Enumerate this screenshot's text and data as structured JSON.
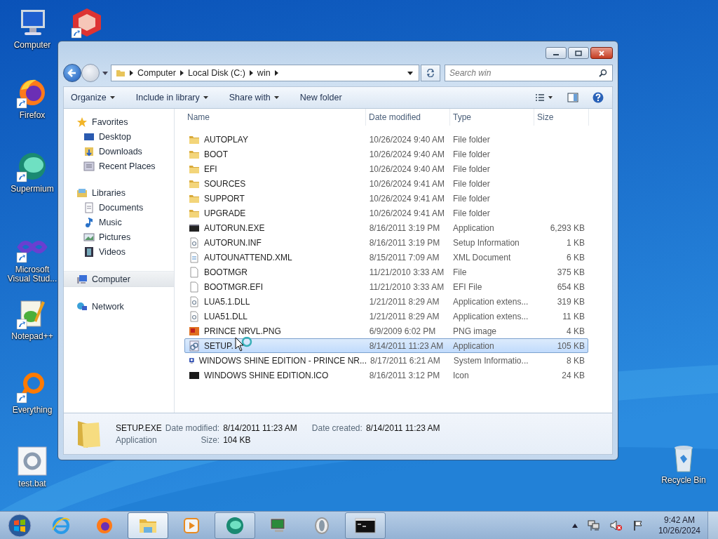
{
  "desktop_icons": [
    {
      "kind": "computer",
      "label": "Computer"
    },
    {
      "kind": "red-box"
    },
    {
      "kind": "firefox",
      "label": "Firefox"
    },
    {
      "kind": "supermium",
      "label": "Supermium"
    },
    {
      "kind": "infinity",
      "label": "Microsoft Visual Stud..."
    },
    {
      "kind": "notepad",
      "label": "Notepad++"
    },
    {
      "kind": "everything",
      "label": "Everything"
    },
    {
      "kind": "bat",
      "label": "test.bat"
    },
    {
      "kind": "recycle",
      "label": "Recycle Bin"
    }
  ],
  "window": {
    "breadcrumb": [
      "Computer",
      "Local Disk (C:)",
      "win"
    ],
    "search": {
      "placeholder": "Search win"
    },
    "toolbar": [
      {
        "label": "Organize",
        "dropdown": true
      },
      {
        "label": "Include in library",
        "dropdown": true
      },
      {
        "label": "Share with",
        "dropdown": true
      },
      {
        "label": "New folder",
        "dropdown": false
      }
    ],
    "nav": [
      {
        "label": "Favorites",
        "kind": "star",
        "selected": false,
        "children": [
          {
            "label": "Desktop",
            "kind": "desktop",
            "selected": false
          },
          {
            "label": "Downloads",
            "kind": "downloads",
            "selected": false
          },
          {
            "label": "Recent Places",
            "kind": "recent",
            "selected": false
          }
        ]
      },
      {
        "label": "Libraries",
        "kind": "library",
        "selected": false,
        "children": [
          {
            "label": "Documents",
            "kind": "doc",
            "selected": false
          },
          {
            "label": "Music",
            "kind": "music",
            "selected": false
          },
          {
            "label": "Pictures",
            "kind": "pictures",
            "selected": false
          },
          {
            "label": "Videos",
            "kind": "videos",
            "selected": false
          }
        ]
      },
      {
        "label": "Computer",
        "kind": "computer",
        "selected": true
      },
      {
        "label": "Network",
        "kind": "network",
        "selected": false
      }
    ],
    "columns": [
      "Name",
      "Date modified",
      "Type",
      "Size"
    ],
    "rows": [
      {
        "kind": "folder",
        "name": "AUTOPLAY",
        "date": "10/26/2024 9:40 AM",
        "type": "File folder",
        "selected": false
      },
      {
        "kind": "folder",
        "name": "BOOT",
        "date": "10/26/2024 9:40 AM",
        "type": "File folder",
        "selected": false
      },
      {
        "kind": "folder",
        "name": "EFI",
        "date": "10/26/2024 9:40 AM",
        "type": "File folder",
        "selected": false
      },
      {
        "kind": "folder",
        "name": "SOURCES",
        "date": "10/26/2024 9:41 AM",
        "type": "File folder",
        "selected": false
      },
      {
        "kind": "folder",
        "name": "SUPPORT",
        "date": "10/26/2024 9:41 AM",
        "type": "File folder",
        "selected": false
      },
      {
        "kind": "folder",
        "name": "UPGRADE",
        "date": "10/26/2024 9:41 AM",
        "type": "File folder",
        "selected": false
      },
      {
        "kind": "exe",
        "name": "AUTORUN.EXE",
        "date": "8/16/2011 3:19 PM",
        "type": "Application",
        "size": "6,293 KB",
        "selected": false
      },
      {
        "kind": "inf",
        "name": "AUTORUN.INF",
        "date": "8/16/2011 3:19 PM",
        "type": "Setup Information",
        "size": "1 KB",
        "selected": false
      },
      {
        "kind": "xml",
        "name": "AUTOUNATTEND.XML",
        "date": "8/15/2011 7:09 AM",
        "type": "XML Document",
        "size": "6 KB",
        "selected": false
      },
      {
        "kind": "file",
        "name": "BOOTMGR",
        "date": "11/21/2010 3:33 AM",
        "type": "File",
        "size": "375 KB",
        "selected": false
      },
      {
        "kind": "file",
        "name": "BOOTMGR.EFI",
        "date": "11/21/2010 3:33 AM",
        "type": "EFI File",
        "size": "654 KB",
        "selected": false
      },
      {
        "kind": "dll",
        "name": "LUA5.1.DLL",
        "date": "1/21/2011 8:29 AM",
        "type": "Application extens...",
        "size": "319 KB",
        "selected": false
      },
      {
        "kind": "dll",
        "name": "LUA51.DLL",
        "date": "1/21/2011 8:29 AM",
        "type": "Application extens...",
        "size": "11 KB",
        "selected": false
      },
      {
        "kind": "png",
        "name": "PRINCE NRVL.PNG",
        "date": "6/9/2009 6:02 PM",
        "type": "PNG image",
        "size": "4 KB",
        "selected": false
      },
      {
        "kind": "setup",
        "name": "SETUP.",
        "date": "8/14/2011 11:23 AM",
        "type": "Application",
        "size": "105 KB",
        "selected": true,
        "cursor": true
      },
      {
        "kind": "sysinfo",
        "name": "WINDOWS SHINE EDITION - PRINCE NR...",
        "date": "8/17/2011 6:21 AM",
        "type": "System Informatio...",
        "size": "8 KB",
        "selected": false
      },
      {
        "kind": "ico",
        "name": "WINDOWS SHINE EDITION.ICO",
        "date": "8/16/2011 3:12 PM",
        "type": "Icon",
        "size": "24 KB",
        "selected": false
      }
    ],
    "details": {
      "name": "SETUP.EXE",
      "type": "Application",
      "fields": [
        {
          "label": "Date modified:",
          "value": "8/14/2011 11:23 AM"
        },
        {
          "label": "Size:",
          "value": "104 KB"
        },
        {
          "label": "Date created:",
          "value": "8/14/2011 11:23 AM"
        }
      ]
    }
  },
  "taskbar": {
    "items": [
      {
        "kind": "ie",
        "open": false,
        "active": false
      },
      {
        "kind": "firefox",
        "open": false,
        "active": false
      },
      {
        "kind": "explorer",
        "open": true,
        "active": true
      },
      {
        "kind": "media",
        "open": false,
        "active": false
      },
      {
        "kind": "supermium",
        "open": true,
        "active": false
      },
      {
        "kind": "monitor",
        "open": false,
        "active": false
      },
      {
        "kind": "opera",
        "open": false,
        "active": false
      },
      {
        "kind": "cmd",
        "open": true,
        "active": false
      }
    ],
    "time": "9:42 AM",
    "date": "10/26/2024"
  }
}
